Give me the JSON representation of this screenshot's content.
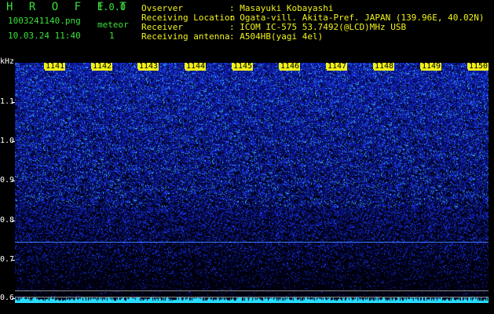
{
  "header": {
    "logo": "H R O F F T",
    "version": "1.0.0",
    "filename": "1003241140.png",
    "datetime": "10.03.24 11:40",
    "meteor_label": "meteor",
    "meteor_count": "1",
    "fields": [
      {
        "label": "Ovserver",
        "value": ": Masayuki Kobayashi"
      },
      {
        "label": "Receiving Location",
        "value": ": Ogata-vill. Akita-Pref. JAPAN (139.96E, 40.02N)"
      },
      {
        "label": "Receiver",
        "value": ": ICOM IC-575 53.7492(@LCD)MHz USB"
      },
      {
        "label": "Receiving antenna",
        "value": ": A504HB(yagi 4el)"
      }
    ]
  },
  "axis": {
    "y_unit": "kHz",
    "y_ticks": [
      "1.1",
      "1.0",
      "0.9",
      "0.8",
      "0.7",
      "0.6"
    ],
    "x_ticks": [
      "1141",
      "1142",
      "1143",
      "1144",
      "1145",
      "1146",
      "1147",
      "1148",
      "1149",
      "1150"
    ]
  },
  "colors": {
    "background": "#000000",
    "header_green": "#39e03a",
    "header_yellow": "#f2f21a",
    "noise_blue": "#2b4bff",
    "noise_cyan": "#35d6ff"
  }
}
